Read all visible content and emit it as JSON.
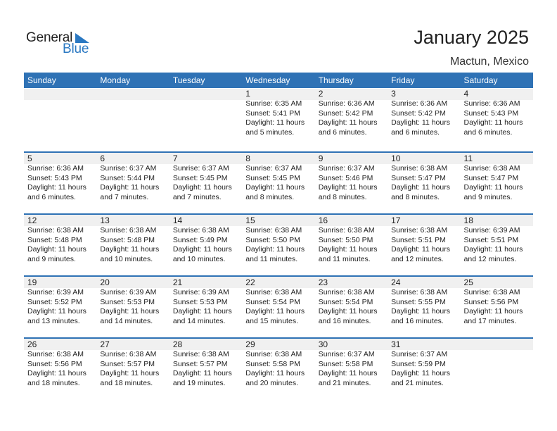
{
  "logo": {
    "general": "General",
    "blue": "Blue",
    "icon": "triangle-flag-icon"
  },
  "header": {
    "title": "January 2025",
    "location": "Mactun, Mexico"
  },
  "colors": {
    "accent": "#2f72b5",
    "daybar": "#f0f0f0",
    "logo_blue": "#2a78c2"
  },
  "weekdays": [
    "Sunday",
    "Monday",
    "Tuesday",
    "Wednesday",
    "Thursday",
    "Friday",
    "Saturday"
  ],
  "weeks": [
    [
      {
        "day": "",
        "sunrise": "",
        "sunset": "",
        "daylight": "",
        "minutes": ""
      },
      {
        "day": "",
        "sunrise": "",
        "sunset": "",
        "daylight": "",
        "minutes": ""
      },
      {
        "day": "",
        "sunrise": "",
        "sunset": "",
        "daylight": "",
        "minutes": ""
      },
      {
        "day": "1",
        "sunrise": "Sunrise: 6:35 AM",
        "sunset": "Sunset: 5:41 PM",
        "daylight": "Daylight: 11 hours",
        "minutes": "and 5 minutes."
      },
      {
        "day": "2",
        "sunrise": "Sunrise: 6:36 AM",
        "sunset": "Sunset: 5:42 PM",
        "daylight": "Daylight: 11 hours",
        "minutes": "and 6 minutes."
      },
      {
        "day": "3",
        "sunrise": "Sunrise: 6:36 AM",
        "sunset": "Sunset: 5:42 PM",
        "daylight": "Daylight: 11 hours",
        "minutes": "and 6 minutes."
      },
      {
        "day": "4",
        "sunrise": "Sunrise: 6:36 AM",
        "sunset": "Sunset: 5:43 PM",
        "daylight": "Daylight: 11 hours",
        "minutes": "and 6 minutes."
      }
    ],
    [
      {
        "day": "5",
        "sunrise": "Sunrise: 6:36 AM",
        "sunset": "Sunset: 5:43 PM",
        "daylight": "Daylight: 11 hours",
        "minutes": "and 6 minutes."
      },
      {
        "day": "6",
        "sunrise": "Sunrise: 6:37 AM",
        "sunset": "Sunset: 5:44 PM",
        "daylight": "Daylight: 11 hours",
        "minutes": "and 7 minutes."
      },
      {
        "day": "7",
        "sunrise": "Sunrise: 6:37 AM",
        "sunset": "Sunset: 5:45 PM",
        "daylight": "Daylight: 11 hours",
        "minutes": "and 7 minutes."
      },
      {
        "day": "8",
        "sunrise": "Sunrise: 6:37 AM",
        "sunset": "Sunset: 5:45 PM",
        "daylight": "Daylight: 11 hours",
        "minutes": "and 8 minutes."
      },
      {
        "day": "9",
        "sunrise": "Sunrise: 6:37 AM",
        "sunset": "Sunset: 5:46 PM",
        "daylight": "Daylight: 11 hours",
        "minutes": "and 8 minutes."
      },
      {
        "day": "10",
        "sunrise": "Sunrise: 6:38 AM",
        "sunset": "Sunset: 5:47 PM",
        "daylight": "Daylight: 11 hours",
        "minutes": "and 8 minutes."
      },
      {
        "day": "11",
        "sunrise": "Sunrise: 6:38 AM",
        "sunset": "Sunset: 5:47 PM",
        "daylight": "Daylight: 11 hours",
        "minutes": "and 9 minutes."
      }
    ],
    [
      {
        "day": "12",
        "sunrise": "Sunrise: 6:38 AM",
        "sunset": "Sunset: 5:48 PM",
        "daylight": "Daylight: 11 hours",
        "minutes": "and 9 minutes."
      },
      {
        "day": "13",
        "sunrise": "Sunrise: 6:38 AM",
        "sunset": "Sunset: 5:48 PM",
        "daylight": "Daylight: 11 hours",
        "minutes": "and 10 minutes."
      },
      {
        "day": "14",
        "sunrise": "Sunrise: 6:38 AM",
        "sunset": "Sunset: 5:49 PM",
        "daylight": "Daylight: 11 hours",
        "minutes": "and 10 minutes."
      },
      {
        "day": "15",
        "sunrise": "Sunrise: 6:38 AM",
        "sunset": "Sunset: 5:50 PM",
        "daylight": "Daylight: 11 hours",
        "minutes": "and 11 minutes."
      },
      {
        "day": "16",
        "sunrise": "Sunrise: 6:38 AM",
        "sunset": "Sunset: 5:50 PM",
        "daylight": "Daylight: 11 hours",
        "minutes": "and 11 minutes."
      },
      {
        "day": "17",
        "sunrise": "Sunrise: 6:38 AM",
        "sunset": "Sunset: 5:51 PM",
        "daylight": "Daylight: 11 hours",
        "minutes": "and 12 minutes."
      },
      {
        "day": "18",
        "sunrise": "Sunrise: 6:39 AM",
        "sunset": "Sunset: 5:51 PM",
        "daylight": "Daylight: 11 hours",
        "minutes": "and 12 minutes."
      }
    ],
    [
      {
        "day": "19",
        "sunrise": "Sunrise: 6:39 AM",
        "sunset": "Sunset: 5:52 PM",
        "daylight": "Daylight: 11 hours",
        "minutes": "and 13 minutes."
      },
      {
        "day": "20",
        "sunrise": "Sunrise: 6:39 AM",
        "sunset": "Sunset: 5:53 PM",
        "daylight": "Daylight: 11 hours",
        "minutes": "and 14 minutes."
      },
      {
        "day": "21",
        "sunrise": "Sunrise: 6:39 AM",
        "sunset": "Sunset: 5:53 PM",
        "daylight": "Daylight: 11 hours",
        "minutes": "and 14 minutes."
      },
      {
        "day": "22",
        "sunrise": "Sunrise: 6:38 AM",
        "sunset": "Sunset: 5:54 PM",
        "daylight": "Daylight: 11 hours",
        "minutes": "and 15 minutes."
      },
      {
        "day": "23",
        "sunrise": "Sunrise: 6:38 AM",
        "sunset": "Sunset: 5:54 PM",
        "daylight": "Daylight: 11 hours",
        "minutes": "and 16 minutes."
      },
      {
        "day": "24",
        "sunrise": "Sunrise: 6:38 AM",
        "sunset": "Sunset: 5:55 PM",
        "daylight": "Daylight: 11 hours",
        "minutes": "and 16 minutes."
      },
      {
        "day": "25",
        "sunrise": "Sunrise: 6:38 AM",
        "sunset": "Sunset: 5:56 PM",
        "daylight": "Daylight: 11 hours",
        "minutes": "and 17 minutes."
      }
    ],
    [
      {
        "day": "26",
        "sunrise": "Sunrise: 6:38 AM",
        "sunset": "Sunset: 5:56 PM",
        "daylight": "Daylight: 11 hours",
        "minutes": "and 18 minutes."
      },
      {
        "day": "27",
        "sunrise": "Sunrise: 6:38 AM",
        "sunset": "Sunset: 5:57 PM",
        "daylight": "Daylight: 11 hours",
        "minutes": "and 18 minutes."
      },
      {
        "day": "28",
        "sunrise": "Sunrise: 6:38 AM",
        "sunset": "Sunset: 5:57 PM",
        "daylight": "Daylight: 11 hours",
        "minutes": "and 19 minutes."
      },
      {
        "day": "29",
        "sunrise": "Sunrise: 6:38 AM",
        "sunset": "Sunset: 5:58 PM",
        "daylight": "Daylight: 11 hours",
        "minutes": "and 20 minutes."
      },
      {
        "day": "30",
        "sunrise": "Sunrise: 6:37 AM",
        "sunset": "Sunset: 5:58 PM",
        "daylight": "Daylight: 11 hours",
        "minutes": "and 21 minutes."
      },
      {
        "day": "31",
        "sunrise": "Sunrise: 6:37 AM",
        "sunset": "Sunset: 5:59 PM",
        "daylight": "Daylight: 11 hours",
        "minutes": "and 21 minutes."
      },
      {
        "day": "",
        "sunrise": "",
        "sunset": "",
        "daylight": "",
        "minutes": ""
      }
    ]
  ]
}
